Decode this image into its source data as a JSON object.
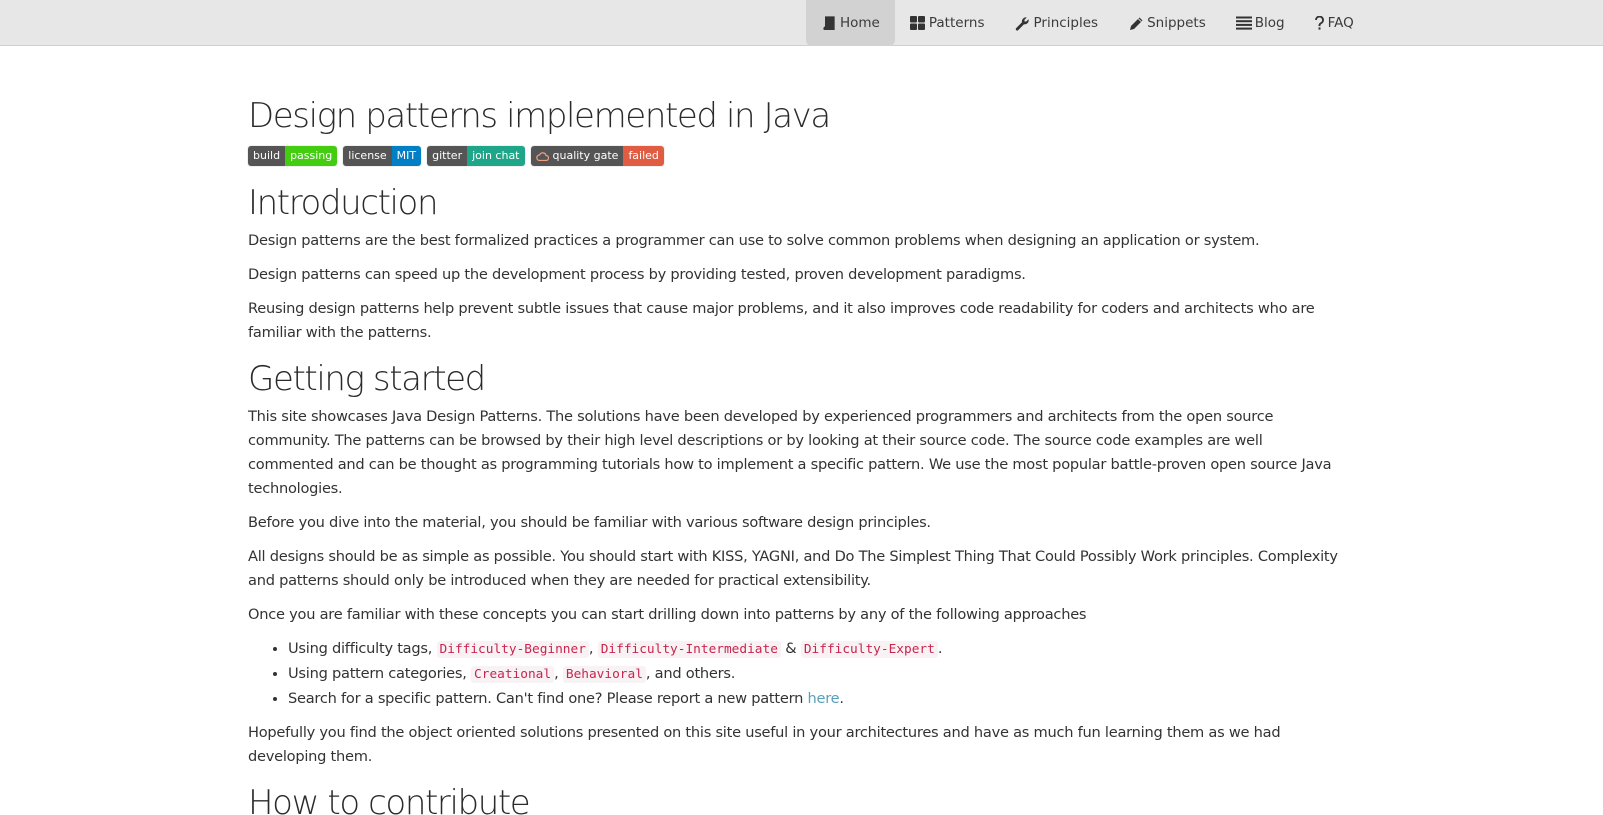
{
  "nav": {
    "items": [
      {
        "label": "Home",
        "icon": "book-icon",
        "active": true
      },
      {
        "label": "Patterns",
        "icon": "grid-icon",
        "active": false
      },
      {
        "label": "Principles",
        "icon": "wrench-icon",
        "active": false
      },
      {
        "label": "Snippets",
        "icon": "pencil-icon",
        "active": false
      },
      {
        "label": "Blog",
        "icon": "list-icon",
        "active": false
      },
      {
        "label": "FAQ",
        "icon": "question-icon",
        "active": false
      }
    ]
  },
  "page": {
    "title": "Design patterns implemented in Java",
    "badges": [
      {
        "left": "build",
        "right": "passing",
        "color": "#44cc11"
      },
      {
        "left": "license",
        "right": "MIT",
        "color": "#007ec6"
      },
      {
        "left": "gitter",
        "right": "join chat",
        "color": "#1fa588"
      },
      {
        "left": "quality gate",
        "right": "failed",
        "color": "#e05d44"
      }
    ]
  },
  "intro": {
    "heading": "Introduction",
    "p1": "Design patterns are the best formalized practices a programmer can use to solve common problems when designing an application or system.",
    "p2": "Design patterns can speed up the development process by providing tested, proven development paradigms.",
    "p3": "Reusing design patterns help prevent subtle issues that cause major problems, and it also improves code readability for coders and architects who are familiar with the patterns."
  },
  "getting_started": {
    "heading": "Getting started",
    "p1": "This site showcases Java Design Patterns. The solutions have been developed by experienced programmers and architects from the open source community. The patterns can be browsed by their high level descriptions or by looking at their source code. The source code examples are well commented and can be thought as programming tutorials how to implement a specific pattern. We use the most popular battle-proven open source Java technologies.",
    "p2": "Before you dive into the material, you should be familiar with various software design principles.",
    "p3": "All designs should be as simple as possible. You should start with KISS, YAGNI, and Do The Simplest Thing That Could Possibly Work principles. Complexity and patterns should only be introduced when they are needed for practical extensibility.",
    "p4": "Once you are familiar with these concepts you can start drilling down into patterns by any of the following approaches",
    "list": {
      "item1_prefix": "Using difficulty tags,",
      "tag_beginner": "Difficulty-Beginner",
      "comma1": ",",
      "tag_intermediate": "Difficulty-Intermediate",
      "amp": "&",
      "tag_expert": "Difficulty-Expert",
      "period1": ".",
      "item2_prefix": "Using pattern categories,",
      "tag_creational": "Creational",
      "comma2": ",",
      "tag_behavioral": "Behavioral",
      "item2_suffix": ", and others.",
      "item3_prefix": "Search for a specific pattern. Can't find one? Please report a new pattern",
      "here_link": "here",
      "period3": "."
    },
    "p5": "Hopefully you find the object oriented solutions presented on this site useful in your architectures and have as much fun learning them as we had developing them."
  },
  "contribute": {
    "heading": "How to contribute"
  }
}
